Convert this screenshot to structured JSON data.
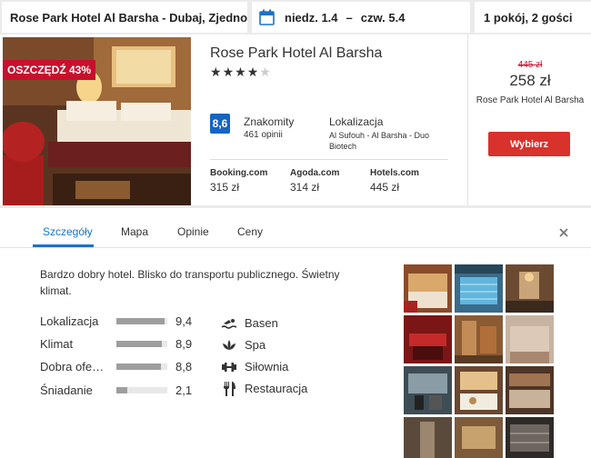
{
  "search": {
    "destination": "Rose Park Hotel Al Barsha - Dubaj, Zjednoczone Emiraty Arabskie",
    "check_in": "niedz. 1.4",
    "date_separator": "–",
    "check_out": "czw. 5.4",
    "rooms_guests": "1 pokój, 2 gości"
  },
  "hotel": {
    "discount_badge": "OSZCZĘDŹ 43%",
    "name": "Rose Park Hotel Al Barsha",
    "stars": 4,
    "score": "8,6",
    "rating_label": "Znakomity",
    "reviews": "461 opinii",
    "location_label": "Lokalizacja",
    "location_text": "Al Sufouh - Al Barsha - Duo Biotech",
    "partners": [
      {
        "name": "Booking.com",
        "price": "315 zł"
      },
      {
        "name": "Agoda.com",
        "price": "314 zł"
      },
      {
        "name": "Hotels.com",
        "price": "445 zł"
      }
    ],
    "old_price": "445 zł",
    "price": "258 zł",
    "price_site": "Rose Park Hotel Al Barsha",
    "select_label": "Wybierz"
  },
  "details": {
    "tabs": [
      "Szczegóły",
      "Mapa",
      "Opinie",
      "Ceny"
    ],
    "active_tab": 0,
    "description": "Bardzo dobry hotel. Blisko do transportu publicznego. Świetny klimat.",
    "metrics": [
      {
        "label": "Lokalizacja",
        "value": "9,4",
        "score": 9.4
      },
      {
        "label": "Klimat",
        "value": "8,9",
        "score": 8.9
      },
      {
        "label": "Dobra ofe…",
        "value": "8,8",
        "score": 8.8
      },
      {
        "label": "Śniadanie",
        "value": "2,1",
        "score": 2.1
      }
    ],
    "amenities": [
      {
        "label": "Basen",
        "icon": "swimmer-icon"
      },
      {
        "label": "Spa",
        "icon": "lotus-icon"
      },
      {
        "label": "Siłownia",
        "icon": "dumbbell-icon"
      },
      {
        "label": "Restauracja",
        "icon": "fork-knife-icon"
      }
    ]
  },
  "colors": {
    "accent_blue": "#1a73c8",
    "score_blue": "#1565c0",
    "badge_red": "#c8102e",
    "button_red": "#d9312c"
  }
}
